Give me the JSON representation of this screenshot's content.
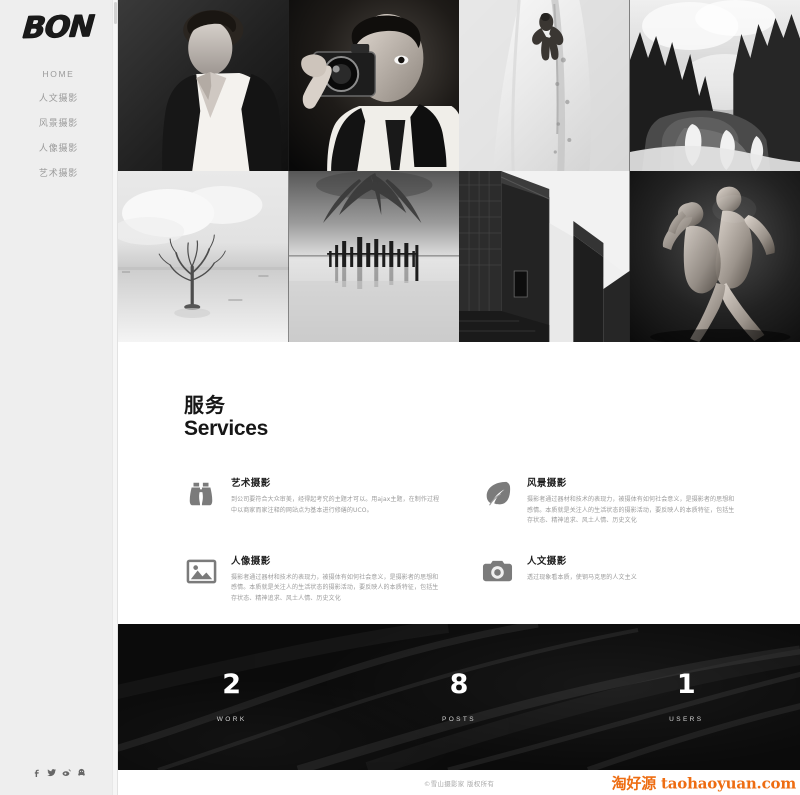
{
  "sidebar": {
    "logo": "BON",
    "nav": [
      {
        "label": "HOME",
        "type": "en"
      },
      {
        "label": "人文摄影",
        "type": "cn"
      },
      {
        "label": "风景摄影",
        "type": "cn"
      },
      {
        "label": "人像摄影",
        "type": "cn"
      },
      {
        "label": "艺术摄影",
        "type": "cn"
      }
    ],
    "social": [
      "facebook-icon",
      "twitter-icon",
      "weibo-icon",
      "qq-icon"
    ]
  },
  "gallery": {
    "items": [
      {
        "name": "male-model-open-shirt",
        "alt": "男模特黑白人像"
      },
      {
        "name": "photographer-with-camera",
        "alt": "手持相机的摄影师"
      },
      {
        "name": "snow-climber",
        "alt": "雪坡攀登者"
      },
      {
        "name": "forest-waterfall",
        "alt": "森林瀑布"
      },
      {
        "name": "lone-tree-in-water",
        "alt": "水中孤树"
      },
      {
        "name": "sea-posts-long-exposure",
        "alt": "海上木桩长曝光"
      },
      {
        "name": "modern-architecture",
        "alt": "现代建筑几何"
      },
      {
        "name": "dancers-duet",
        "alt": "双人舞者"
      }
    ]
  },
  "services": {
    "heading_cn": "服务",
    "heading_en": "Services",
    "items": [
      {
        "icon": "binoculars-icon",
        "title": "艺术摄影",
        "desc": "到公司要符合大众审美，经得起考究的主题才可以。用ajax主题，在制作过程中以商家而家注释的网站点为基本进行修缮的UCO。"
      },
      {
        "icon": "leaf-icon",
        "title": "风景摄影",
        "desc": "摄影者通过器材和技术的表现力，被摄体有如何社会意义，是摄影者的思想和感情。本质就是关注人的生活状态的摄影活动，要反映人的本质特征，包括生存状态、精神追求、风土人情、历史文化"
      },
      {
        "icon": "image-icon",
        "title": "人像摄影",
        "desc": "摄影者通过器材和技术的表现力，被摄体有如何社会意义，是摄影者的思想和感情。本质就是关注人的生活状态的摄影活动，要反映人的本质特征，包括生存状态、精神追求、风土人情、历史文化"
      },
      {
        "icon": "camera-icon",
        "title": "人文摄影",
        "desc": "透过现象看本质，使钢马克思的人文主义"
      }
    ]
  },
  "stats": [
    {
      "value": "2",
      "label": "WORK"
    },
    {
      "value": "8",
      "label": "POSTS"
    },
    {
      "value": "1",
      "label": "USERS"
    }
  ],
  "footer": {
    "copyright": "©雪山摄影家 版权所有",
    "watermark_cn": "淘好源",
    "watermark_en": "taohaoyuan.com"
  },
  "colors": {
    "sidebar_bg": "#eeeeee",
    "stats_bg": "#0b0b0b",
    "watermark": "#ee6d12",
    "nav_text": "#9a9a9a"
  }
}
